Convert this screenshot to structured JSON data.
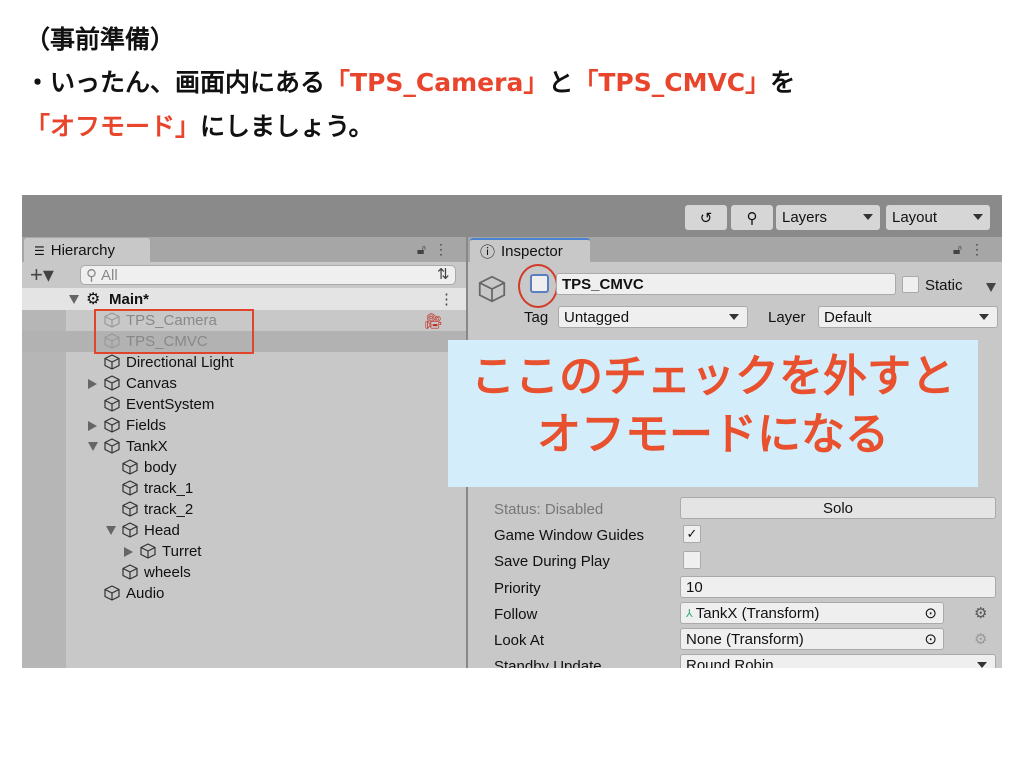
{
  "slide": {
    "title": "（事前準備）",
    "line2_a": "・いったん、画面内にある",
    "line2_b": "「TPS_Camera」",
    "line2_c": "と",
    "line2_d": "「TPS_CMVC」",
    "line2_e": "を",
    "line3_a": "「オフモード」",
    "line3_b": "にしましょう。"
  },
  "colors": {
    "accent_red": "#e8452c",
    "callout_bg": "#d3eefa"
  },
  "toolbar": {
    "history_icon": "history-icon",
    "search_icon": "search-icon",
    "layers": "Layers",
    "layout": "Layout"
  },
  "hierarchy": {
    "tab": "Hierarchy",
    "search_placeholder": "All",
    "scene": "Main*",
    "items": [
      {
        "label": "TPS_Camera",
        "depth": 1,
        "disabled": true
      },
      {
        "label": "TPS_CMVC",
        "depth": 1,
        "disabled": true,
        "selected": true
      },
      {
        "label": "Directional Light",
        "depth": 1
      },
      {
        "label": "Canvas",
        "depth": 1,
        "toggle": "collapsed"
      },
      {
        "label": "EventSystem",
        "depth": 1
      },
      {
        "label": "Fields",
        "depth": 1,
        "toggle": "collapsed"
      },
      {
        "label": "TankX",
        "depth": 1,
        "toggle": "expanded"
      },
      {
        "label": "body",
        "depth": 2
      },
      {
        "label": "track_1",
        "depth": 2
      },
      {
        "label": "track_2",
        "depth": 2
      },
      {
        "label": "Head",
        "depth": 2,
        "toggle": "expanded"
      },
      {
        "label": "Turret",
        "depth": 3,
        "toggle": "collapsed"
      },
      {
        "label": "wheels",
        "depth": 2
      },
      {
        "label": "Audio",
        "depth": 1
      }
    ]
  },
  "inspector": {
    "tab": "Inspector",
    "object_name": "TPS_CMVC",
    "active": false,
    "static_label": "Static",
    "static": false,
    "tag_label": "Tag",
    "tag": "Untagged",
    "layer_label": "Layer",
    "layer": "Default",
    "status": "Status: Disabled",
    "solo": "Solo",
    "game_window_guides": "Game Window Guides",
    "game_window_guides_checked": true,
    "save_during_play": "Save During Play",
    "save_during_play_checked": false,
    "priority_label": "Priority",
    "priority": "10",
    "follow_label": "Follow",
    "follow": "TankX (Transform)",
    "look_at_label": "Look At",
    "look_at": "None (Transform)",
    "standby_label": "Standby Update",
    "standby": "Round Robin"
  },
  "callout": {
    "line1": "ここのチェックを外すと",
    "line2": "オフモードになる"
  }
}
